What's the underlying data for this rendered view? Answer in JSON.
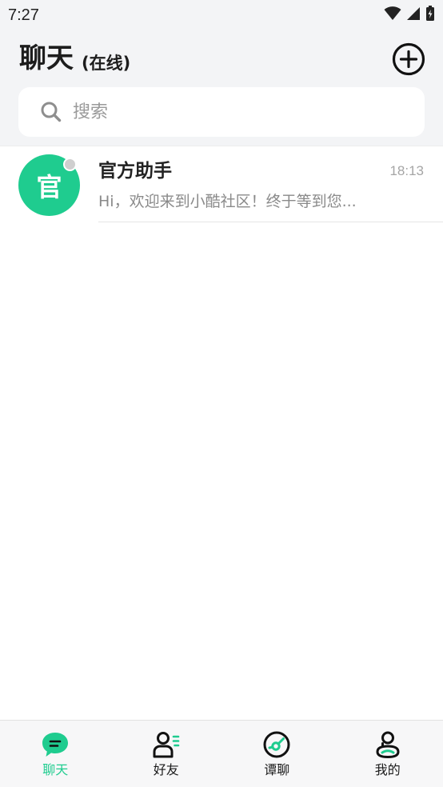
{
  "status_bar": {
    "time": "7:27"
  },
  "header": {
    "title": "聊天",
    "subtitle": "(在线)"
  },
  "search": {
    "placeholder": "搜索",
    "value": ""
  },
  "chats": [
    {
      "avatar_text": "官",
      "name": "官方助手",
      "time": "18:13",
      "preview": "Hi，欢迎来到小酷社区！终于等到您...",
      "online": false
    }
  ],
  "tabs": [
    {
      "label": "聊天",
      "icon": "chat-bubble-icon",
      "active": true
    },
    {
      "label": "好友",
      "icon": "friends-icon",
      "active": false
    },
    {
      "label": "谭聊",
      "icon": "discover-icon",
      "active": false
    },
    {
      "label": "我的",
      "icon": "profile-icon",
      "active": false
    }
  ],
  "colors": {
    "accent": "#1fcc8f",
    "header_bg": "#f3f4f6"
  }
}
